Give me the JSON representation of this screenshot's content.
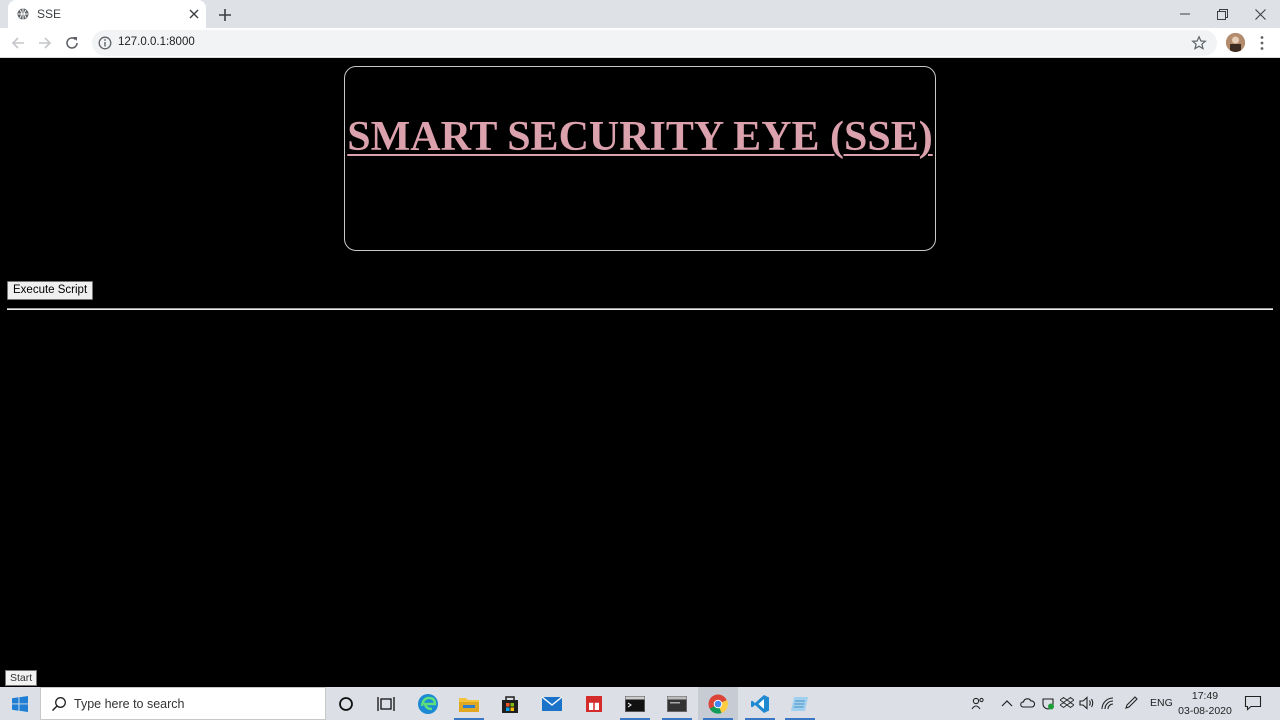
{
  "browser": {
    "tab_title": "SSE",
    "url": "127.0.0.1:8000"
  },
  "page": {
    "heading": "SMART SECURITY EYE (SSE)",
    "execute_button_label": "Execute Script",
    "tooltip": "Start"
  },
  "taskbar": {
    "search_placeholder": "Type here to search",
    "language": "ENG",
    "time": "17:49",
    "date": "03-08-2020",
    "pinned": [
      "cortana-icon",
      "task-view-icon",
      "edge-icon",
      "file-explorer-icon",
      "store-icon",
      "mail-icon",
      "gift-app-icon",
      "terminal-icon",
      "terminal-2-icon",
      "chrome-icon",
      "vscode-icon",
      "notepad-icon"
    ]
  },
  "colors": {
    "heading": "#dba1ad",
    "page_background": "#000000",
    "taskbar_accent": "#3a78c6"
  }
}
